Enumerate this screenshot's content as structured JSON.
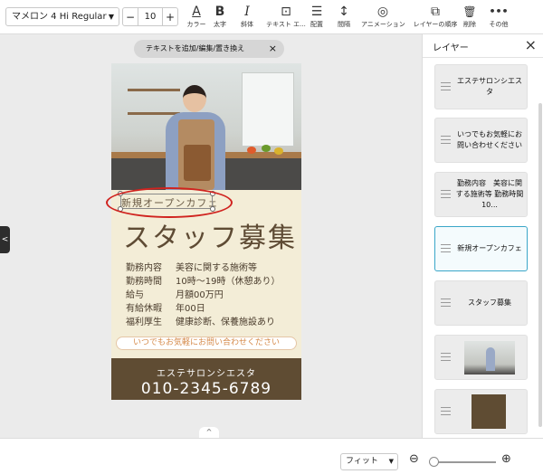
{
  "toolbar": {
    "font_name": "マメロン 4 Hi Regular",
    "font_size": "10",
    "minus": "−",
    "plus": "+",
    "tools": [
      {
        "icon": "A",
        "label": "カラー"
      },
      {
        "icon": "B",
        "label": "太字"
      },
      {
        "icon": "I",
        "label": "斜体"
      },
      {
        "icon": "⊡",
        "label": "テキスト エ..."
      },
      {
        "icon": "☰",
        "label": "配置"
      },
      {
        "icon": "↕",
        "label": "間隔"
      },
      {
        "icon": "◎",
        "label": "アニメーション"
      },
      {
        "icon": "⧉",
        "label": "レイヤーの順序"
      },
      {
        "icon": "🗑",
        "label": "削除"
      },
      {
        "icon": "•••",
        "label": "その他"
      }
    ]
  },
  "canvas": {
    "hint": "テキストを追加/編集/置き換え",
    "hint_close": "×",
    "left_tab": "<",
    "poster": {
      "subtitle": "新規オープンカフェ",
      "title": "スタッフ募集",
      "details": [
        {
          "key": "勤務内容",
          "value": "美容に関する施術等"
        },
        {
          "key": "勤務時間",
          "value": "10時〜19時（休憩あり）"
        },
        {
          "key": "給与",
          "value": "月額00万円"
        },
        {
          "key": "有給休暇",
          "value": "年00日"
        },
        {
          "key": "福利厚生",
          "value": "健康診断、保養施設あり"
        }
      ],
      "cta": "いつでもお気軽にお問い合わせください",
      "salon_name": "エステサロンシエスタ",
      "phone": "010-2345-6789"
    }
  },
  "layers": {
    "title": "レイヤー",
    "close": "×",
    "items": [
      {
        "type": "text",
        "label": "エステサロンシエスタ"
      },
      {
        "type": "text",
        "label": "いつでもお気軽にお問い合わせください"
      },
      {
        "type": "text",
        "label": "勤務内容　美容に関する施術等 勤務時間　10..."
      },
      {
        "type": "text",
        "label": "新規オープンカフェ",
        "selected": true
      },
      {
        "type": "text",
        "label": "スタッフ募集"
      },
      {
        "type": "image",
        "label": ""
      },
      {
        "type": "shape",
        "label": ""
      }
    ]
  },
  "bottom": {
    "collapse": "^",
    "zoom_mode": "フィット",
    "zoom_out": "⊖",
    "zoom_in": "⊕"
  },
  "colors": {
    "poster_bg": "#f3edd7",
    "band": "#5f4c33",
    "annotation": "#d0231f",
    "selection": "#3aa6c8"
  }
}
